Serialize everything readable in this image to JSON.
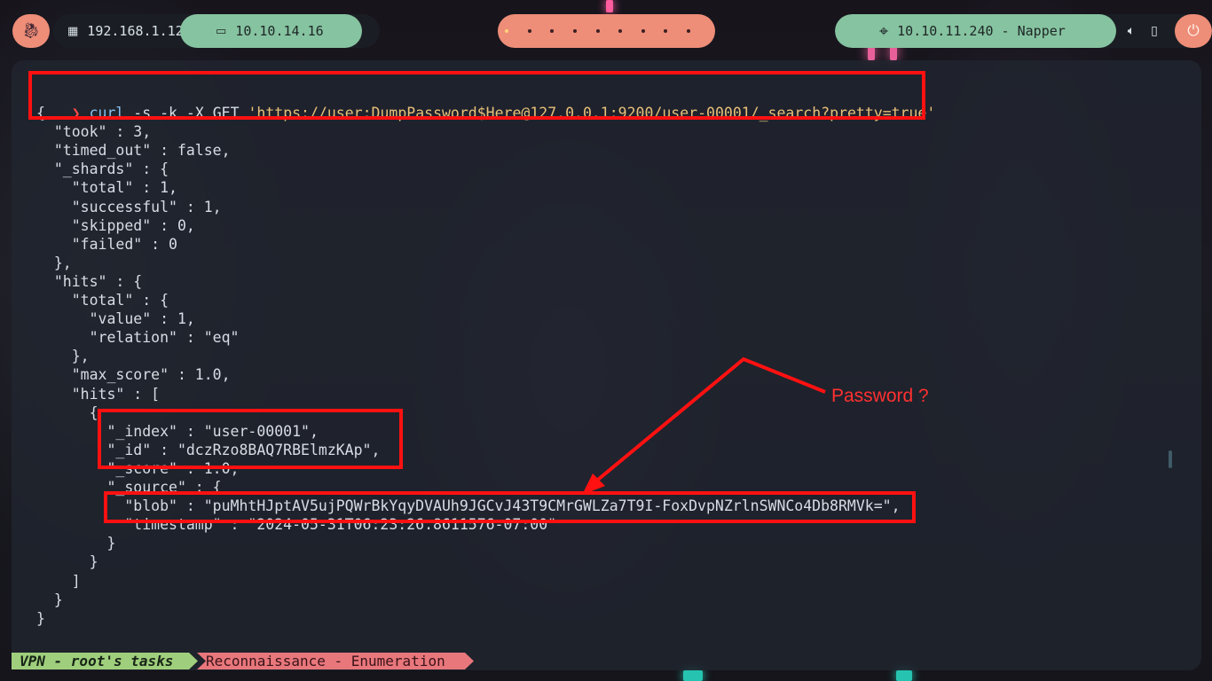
{
  "topbar": {
    "menu_icon": "kali-dragon-icon",
    "network": [
      {
        "icon": "ethernet-icon",
        "ip": "192.168.1.12"
      },
      {
        "icon": "laptop-icon",
        "ip": "10.10.14.16"
      }
    ],
    "workspaces": {
      "count": 9,
      "active_index": 0
    },
    "target": {
      "icon": "crosshair-icon",
      "label": "10.10.11.240 - Napper"
    },
    "tray": {
      "volume_icon": "volume-icon",
      "battery_icon": "battery-icon",
      "power_icon": "power-icon"
    },
    "colors": {
      "accent": "#ee8d78",
      "green": "#86c3a0",
      "dark": "#1a1e24"
    }
  },
  "terminal": {
    "prompt_symbol": "❯",
    "command": {
      "name": "curl",
      "args": " -s -k -X GET ",
      "url": "'https://user:DumpPassword$Here@127.0.0.1:9200/user-00001/_search?pretty=true'"
    },
    "output_lines": [
      "{",
      "  \"took\" : 3,",
      "  \"timed_out\" : false,",
      "  \"_shards\" : {",
      "    \"total\" : 1,",
      "    \"successful\" : 1,",
      "    \"skipped\" : 0,",
      "    \"failed\" : 0",
      "  },",
      "  \"hits\" : {",
      "    \"total\" : {",
      "      \"value\" : 1,",
      "      \"relation\" : \"eq\"",
      "    },",
      "    \"max_score\" : 1.0,",
      "    \"hits\" : [",
      "      {",
      "        \"_index\" : \"user-00001\",",
      "        \"_id\" : \"dczRzo8BAQ7RBElmzKAp\",",
      "        \"_score\" : 1.0,",
      "        \"_source\" : {",
      "          \"blob\" : \"puMhtHJptAV5ujPQWrBkYqyDVAUh9JGCvJ43T9CMrGWLZa7T9I-FoxDvpNZrlnSWNCo4Db8RMVk=\",",
      "          \"timestamp\" : \"2024-05-31T06:23:26.8611576-07:00\"",
      "        }",
      "      }",
      "    ]",
      "  }",
      "}"
    ],
    "annotation_label": "Password ?",
    "annotation_color": "#ff1111"
  },
  "statusbar": {
    "vpn_label": "VPN - root's tasks",
    "task_label": "Reconnaissance - Enumeration",
    "colors": {
      "vpn": "#9fcf7c",
      "task": "#e8777c"
    }
  }
}
